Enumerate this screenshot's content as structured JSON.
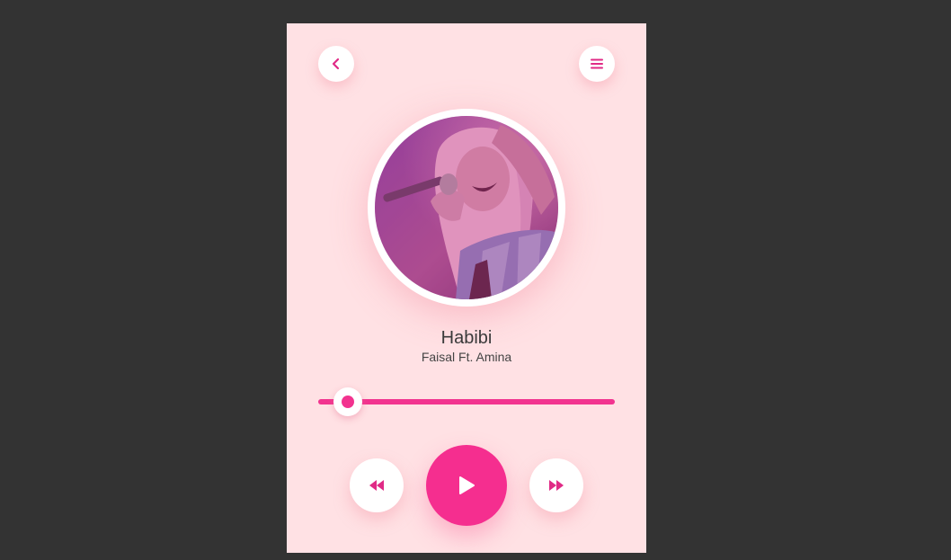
{
  "header": {
    "back_icon": "chevron-left-icon",
    "menu_icon": "hamburger-menu-icon"
  },
  "track": {
    "title": "Habibi",
    "artist": "Faisal Ft. Amina",
    "progress_fraction": 0.1
  },
  "controls": {
    "rewind_icon": "rewind-icon",
    "play_icon": "play-icon",
    "forward_icon": "fast-forward-icon"
  },
  "colors": {
    "accent": "#f52e8f",
    "panel_background": "#ffe1e4",
    "page_background": "#333333"
  }
}
